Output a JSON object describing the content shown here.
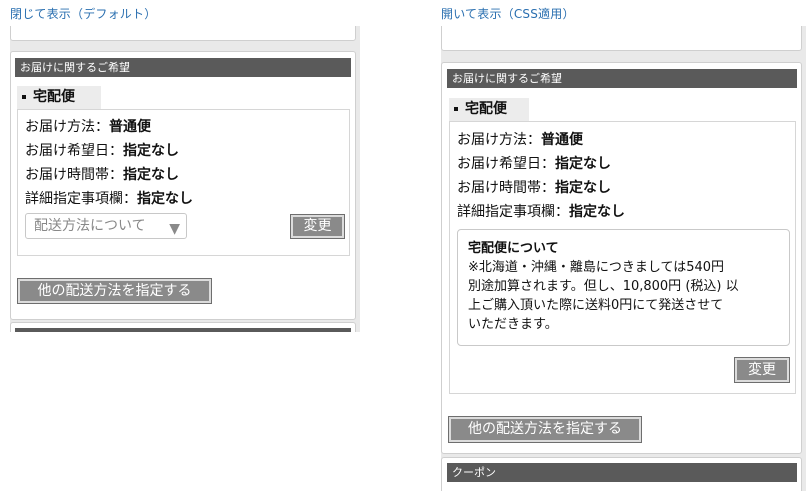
{
  "captions": {
    "left": "閉じて表示（デフォルト）",
    "right": "開いて表示（CSS適用）"
  },
  "delivery": {
    "section_title": "お届けに関するご希望",
    "method_tab": "宅配便",
    "rows": [
      {
        "label": "お届け方法：",
        "value": "普通便"
      },
      {
        "label": "お届け希望日：",
        "value": "指定なし"
      },
      {
        "label": "お届け時間帯：",
        "value": "指定なし"
      },
      {
        "label": "詳細指定事項欄：",
        "value": "指定なし"
      }
    ],
    "info_toggle": "配送方法について",
    "change_button": "変更",
    "other_method_button": "他の配送方法を指定する",
    "info_title": "宅配便について",
    "info_lines": [
      "※北海道・沖縄・離島につきましては540円",
      "別途加算されます。但し、10,800円 (税込) 以",
      "上ご購入頂いた際に送料0円にて発送させて",
      "いただきます。"
    ]
  },
  "coupon": {
    "section_title": "クーポン"
  },
  "icons": {
    "toggle_arrow": "triangle-down-icon",
    "bullet": "square-bullet-icon"
  }
}
